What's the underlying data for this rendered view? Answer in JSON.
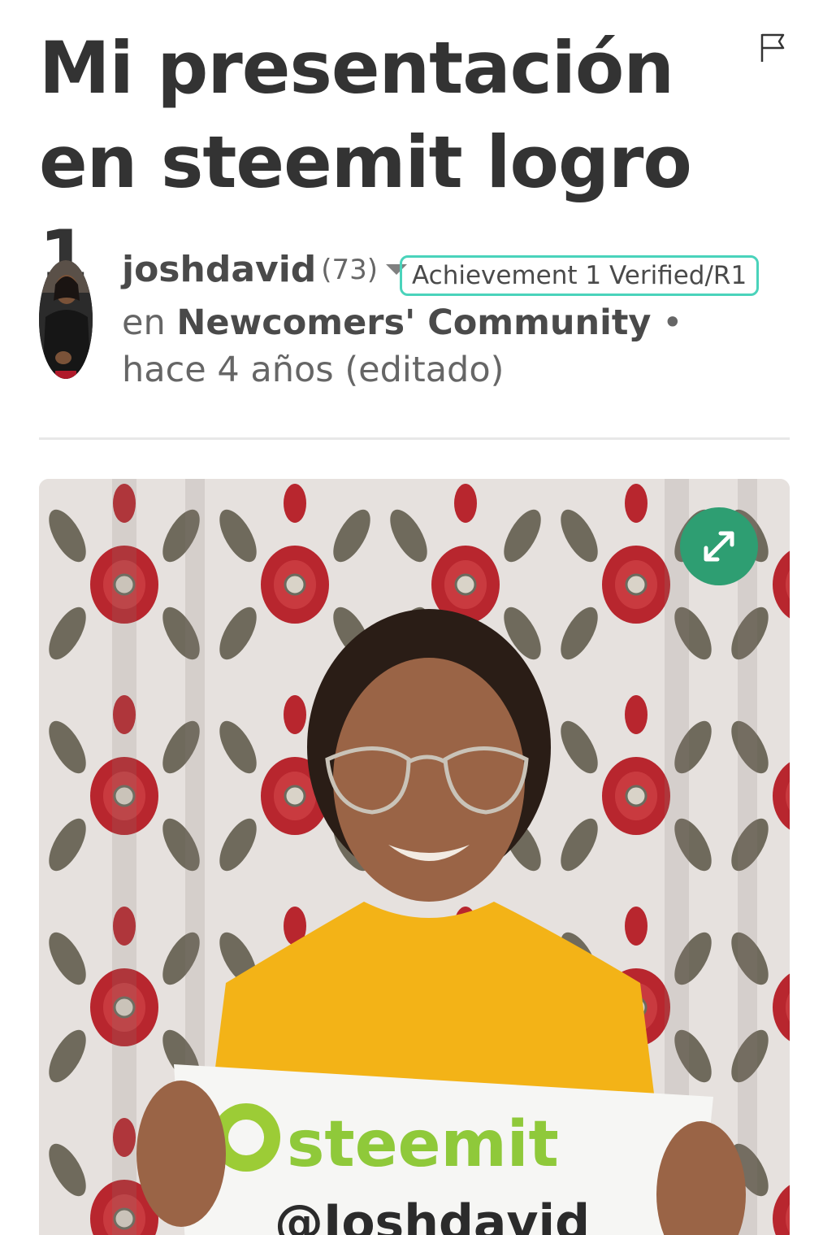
{
  "post": {
    "title": "Mi presentación en steemit logro 1"
  },
  "author": {
    "name": "joshdavid",
    "reputation": "(73)",
    "badge": "Achievement 1 Verified/R1"
  },
  "meta": {
    "in_label": "en",
    "community": "Newcomers' Community",
    "separator": "•",
    "time": "hace 4 años (editado)"
  },
  "photo": {
    "sign_text": "steemit",
    "sign_handle": "@Joshdavid"
  },
  "colors": {
    "accent_green": "#2e9e72",
    "badge_border": "#4ad3bb",
    "title": "#333333",
    "muted": "#666666"
  },
  "icons": {
    "flag": "flag-icon",
    "expand": "expand-icon",
    "caret": "chevron-down-icon"
  }
}
